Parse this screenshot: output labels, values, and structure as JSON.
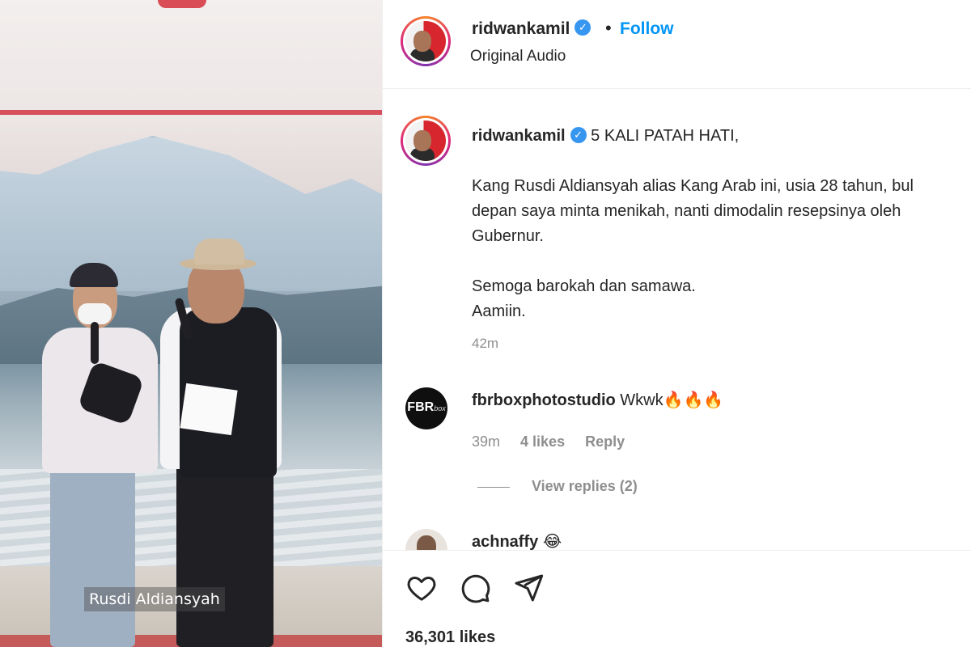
{
  "media": {
    "caption": "Rusdi Aldiansyah"
  },
  "header": {
    "username": "ridwankamil",
    "verified_mark": "✓",
    "separator": "•",
    "follow_label": "Follow",
    "audio_label": "Original Audio"
  },
  "post": {
    "username": "ridwankamil",
    "caption_lines": [
      "5 KALI PATAH HATI,",
      "",
      "Kang Rusdi Aldiansyah alias Kang Arab ini, usia 28 tahun, bul",
      "depan saya minta menikah, nanti dimodalin resepsinya oleh",
      "Gubernur.",
      "",
      "Semoga barokah dan samawa.",
      "Aamiin."
    ],
    "time": "42m"
  },
  "comments": [
    {
      "username": "fbrboxphotostudio",
      "avatar_text": "FBR",
      "avatar_subtext": "box",
      "text": "Wkwk🔥🔥🔥",
      "time": "39m",
      "likes": "4 likes",
      "reply_label": "Reply",
      "view_replies": "View replies (2)"
    },
    {
      "username": "achnaffy",
      "text": "😂"
    }
  ],
  "actions": {
    "like_icon": "heart-icon",
    "comment_icon": "comment-icon",
    "share_icon": "share-icon",
    "likes_count": "36,301 likes"
  },
  "colors": {
    "accent": "#0095f6",
    "verified": "#3797f0",
    "muted": "#8e8e8e",
    "text": "#262626"
  }
}
